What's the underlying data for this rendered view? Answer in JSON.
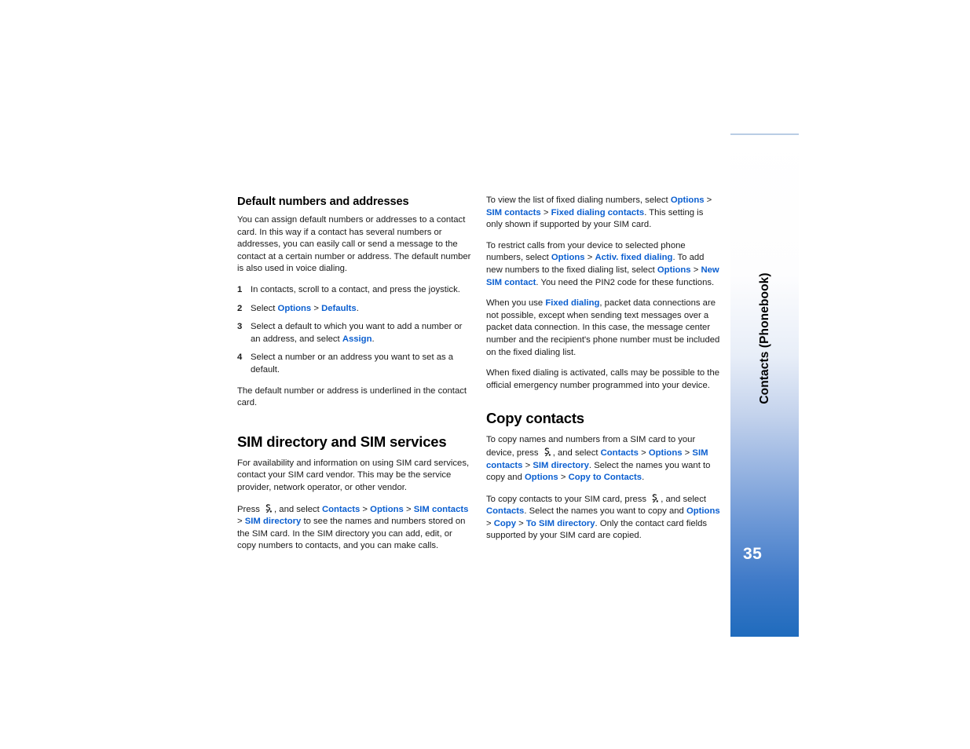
{
  "document": {
    "page_number": "35",
    "sidebar_chapter": "Contacts (Phonebook)",
    "accent_color": "#0b5fd0",
    "sidebar_bottom_color": "#1f6bbd"
  },
  "left_column": {
    "heading_default_numbers": "Default numbers and addresses",
    "intro_paragraph": "You can assign default numbers or addresses to a contact card. In this way if a contact has several numbers or addresses, you can easily call or send a message to the contact at a certain number or address. The default number is also used in voice dialing.",
    "steps": [
      {
        "num": "1",
        "text": "In contacts, scroll to a contact, and press the joystick."
      },
      {
        "num": "2",
        "pre": "Select ",
        "link1": "Options",
        "sep1": " > ",
        "link2": "Defaults",
        "post": "."
      },
      {
        "num": "3",
        "pre": "Select a default to which you want to add a number or an address, and select ",
        "link1": "Assign",
        "post": "."
      },
      {
        "num": "4",
        "text": "Select a number or an address you want to set as a default."
      }
    ],
    "after_steps_paragraph": "The default number or address is underlined in the contact card.",
    "heading_sim_directory": "SIM directory and SIM services",
    "sim_intro_paragraph": "For availability and information on using SIM card services, contact your SIM card vendor. This may be the service provider, network operator, or other vendor.",
    "sim_press_paragraph": {
      "p1": "Press ",
      "icon": "menu-key-icon",
      "p2": ", and select ",
      "l1": "Contacts",
      "s1": " > ",
      "l2": "Options",
      "s2": " > ",
      "l3": "SIM contacts",
      "s3": " > ",
      "l4": "SIM directory",
      "p3": " to see the names and numbers stored on the SIM card. In the SIM directory you can add, edit, or copy numbers to contacts, and you can make calls."
    }
  },
  "right_column": {
    "fixed_dialing_view": {
      "p1": "To view the list of fixed dialing numbers, select ",
      "l1": "Options",
      "s1": " > ",
      "l2": "SIM contacts",
      "s2": " > ",
      "l3": "Fixed dialing contacts",
      "p2": ". This setting is only shown if supported by your SIM card."
    },
    "restrict_calls": {
      "p1": "To restrict calls from your device to selected phone numbers, select ",
      "l1": "Options",
      "s1": " > ",
      "l2": "Activ. fixed dialing",
      "p2": ". To add new numbers to the fixed dialing list, select ",
      "l3": "Options",
      "s2": " > ",
      "l4": "New SIM contact",
      "p3": ". You need the PIN2 code for these functions."
    },
    "packet_data": {
      "p1": "When you use ",
      "l1": "Fixed dialing",
      "p2": ", packet data connections are not possible, except when sending text messages over a packet data connection. In this case, the message center number and the recipient's phone number must be included on the fixed dialing list."
    },
    "emergency_paragraph": "When fixed dialing is activated, calls may be possible to the official emergency number programmed into your device.",
    "heading_copy_contacts": "Copy contacts",
    "copy_to_device_lead": "To copy names and numbers from a SIM card to your",
    "copy_to_device": {
      "p1": "device, press ",
      "icon": "menu-key-icon",
      "p2": ", and select ",
      "l1": "Contacts",
      "s1": " > ",
      "l2": "Options",
      "s2": " > ",
      "l3": "SIM contacts",
      "s3": " > ",
      "l4": "SIM directory",
      "p3": ". Select the names you want to copy and ",
      "l5": "Options",
      "s4": " > ",
      "l6": "Copy to Contacts",
      "p4": "."
    },
    "copy_to_sim": {
      "p1": "To copy contacts to your SIM card, press ",
      "icon": "menu-key-icon",
      "p2": ", and select ",
      "l1": "Contacts",
      "p3": ". Select the names you want to copy and ",
      "l2": "Options",
      "s1": " > ",
      "l3": "Copy",
      "s2": " > ",
      "l4": "To SIM directory",
      "p4": ". Only the contact card fields supported by your SIM card are copied."
    }
  }
}
